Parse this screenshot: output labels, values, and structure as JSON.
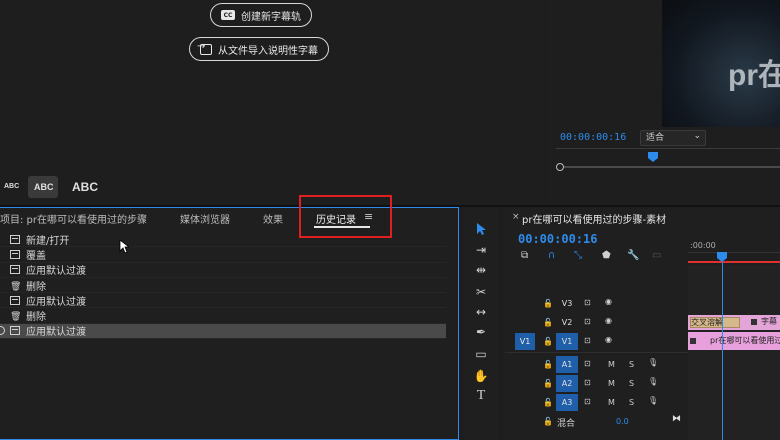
{
  "caption_panel": {
    "create_caption_track": "创建新字幕轨",
    "import_from_file": "从文件导入说明性字幕",
    "cc_glyph": "CC",
    "abc_small": "ABC",
    "abc_medium": "ABC",
    "abc_large": "ABC"
  },
  "program_monitor": {
    "video_text": "pr在",
    "timecode": "00:00:00:16",
    "fit": "适合"
  },
  "project_panel": {
    "tabs": {
      "project": "项目: pr在哪可以看使用过的步骤",
      "media_browser": "媒体浏览器",
      "effects": "效果",
      "history": "历史记录"
    },
    "history": [
      {
        "label": "新建/打开",
        "icon": "document-icon"
      },
      {
        "label": "覆盖",
        "icon": "document-icon"
      },
      {
        "label": "应用默认过渡",
        "icon": "document-icon"
      },
      {
        "label": "删除",
        "icon": "trash-icon"
      },
      {
        "label": "应用默认过渡",
        "icon": "document-icon"
      },
      {
        "label": "删除",
        "icon": "trash-icon"
      },
      {
        "label": "应用默认过渡",
        "icon": "document-icon"
      }
    ]
  },
  "timeline": {
    "close_glyph": "×",
    "title": "pr在哪可以看使用过的步骤-素材",
    "timecode": "00:00:00:16",
    "ruler_start": ":00:00",
    "tracks": {
      "v3": "V3",
      "v2": "V2",
      "v1": "V1",
      "v1_source": "V1",
      "a1": "A1",
      "a2": "A2",
      "a3": "A3",
      "mute": "M",
      "solo": "S"
    },
    "mix_label": "混合",
    "mix_value": "0.0",
    "clip_title_a": "交叉溶解",
    "clip_title_b": "字幕",
    "clip_video_label": "pr在哪可以看使用过"
  }
}
